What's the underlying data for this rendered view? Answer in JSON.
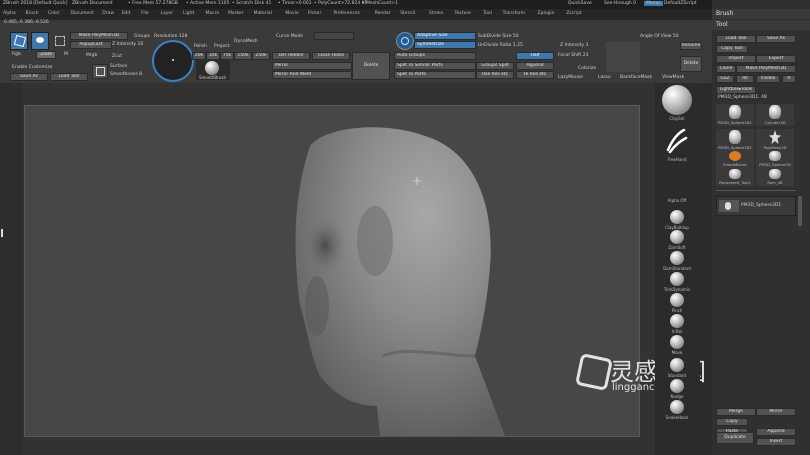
{
  "titlebar": {
    "app": "ZBrush 2018 [Default Quick]",
    "document": "ZBrush Document",
    "free_mem": "• Free Mem 57.278GB",
    "active_mem": "• Active Mem 1105",
    "scratch": "• Scratch Disk 41",
    "timer": "• Timer>0.001",
    "polycount": "• PolyCount>72.824 KP",
    "meshcount": "• MeshCount>1",
    "quicksave": "QuickSave",
    "see_through": "See-through 0",
    "menus": "Menus",
    "default_zscript": "DefaultZScript"
  },
  "menubar": [
    "Alpha",
    "Brush",
    "Color",
    "Document",
    "Draw",
    "Edit",
    "File",
    "Layer",
    "Light",
    "Macro",
    "Marker",
    "Material",
    "Movie",
    "Picker",
    "Preferences",
    "Render",
    "Stencil",
    "Stroke",
    "Texture",
    "Tool",
    "Transform",
    "Zplugin",
    "Zscript"
  ],
  "coords": "0.485,-0.386,-0.526",
  "toolbar": {
    "edit_label": "Edit",
    "draw_label": "Draw",
    "make_polymesh": "Make PolyMesh3D",
    "popup_last": "PopupLast",
    "rgb": "Rgb",
    "m": "M",
    "mrgb": "Mrgb",
    "zadd": "Zadd",
    "zsub": "Zsub",
    "zcut": "Zcut",
    "rgb_intensity": "Rgb Intensity",
    "z_intensity": "Z Intensity 10",
    "focal_shift": "Focal Shift 0",
    "enable_customize": "Enable Customize",
    "save_as": "Save As",
    "load_tool": "Load Tool",
    "scale": "Scale",
    "surface": "Surface",
    "smoothness": "Smoothness 8",
    "groups": "Groups",
    "resolution": "Resolution 128",
    "polish": "Polish",
    "project": "Project",
    "dynamesh": "DynaMesh",
    "preset_20k": "20k",
    "preset_35k": "35k",
    "preset_75k": "75k",
    "preset_150k": "150k",
    "preset_250k": "250k",
    "smoothbrush": "SmoothBrush",
    "curve_mode": "Curve Mode",
    "del_hidden": "Del Hidden",
    "close_holes": "Close Holes",
    "mirror": "Mirror",
    "mirror_and_weld": "Mirror And Weld",
    "delete": "Delete",
    "adaptive_size": "Adaptive Size",
    "symmetrize": "Symmetrize",
    "auto_groups": "Auto Groups",
    "split_to_similar": "Split To Similar Parts",
    "split_to_parts": "Split To Parts",
    "subdivide_size": "SubDivide Size 50",
    "undivide_ratio": "UnDivide Ratio 1.25",
    "groups_split": "Groups Split",
    "use_res_etc": "Use Res etc",
    "half": "Half",
    "append": "Append",
    "hi_res_etc": "Hi Res etc",
    "z_intensity2": "Z Intensity 3",
    "focal_shift2": "Focal Shift 23",
    "colorize": "Colorize",
    "lazymouse": "LazyMouse",
    "lasso": "Lasso",
    "backfacemask": "BackfaceMask",
    "viewmask": "ViewMask",
    "angle_of_view": "Angle Of View 50",
    "rename": "Rename",
    "delete2": "Delete"
  },
  "brushes": [
    {
      "name": "ClaySm",
      "kind": "sphere"
    },
    {
      "name": "FreeHand",
      "kind": "stroke"
    },
    {
      "name": "Alpha Off",
      "kind": "empty"
    },
    {
      "name": "ClayBuildup",
      "kind": "sphere"
    },
    {
      "name": "DamSoft",
      "kind": "sphere"
    },
    {
      "name": "DamStandard",
      "kind": "sphere"
    },
    {
      "name": "TrimDynamic",
      "kind": "sphere"
    },
    {
      "name": "Pinch",
      "kind": "sphere"
    },
    {
      "name": "Inflat",
      "kind": "sphere"
    },
    {
      "name": "Move",
      "kind": "sphere"
    },
    {
      "name": "Standard",
      "kind": "sphere"
    },
    {
      "name": "Nudge",
      "kind": "sphere"
    },
    {
      "name": "SnakeHook",
      "kind": "sphere"
    }
  ],
  "rightpanel": {
    "brush_header": "Brush",
    "tool_header": "Tool",
    "load_tool": "Load Tool",
    "save_as": "Save As",
    "copy_tool": "Copy Tool",
    "import": "Import",
    "export": "Export",
    "clone": "Clone",
    "make_polymesh": "Make PolyMesh3D",
    "goz": "GoZ",
    "all": "All",
    "visible": "Visible",
    "r": "R",
    "lightbox_tools": "Lightbox▸Tools",
    "current_tool": "PM3D_Sphere3D1. 48",
    "thumbs": [
      "PM3D_Sphere3D1",
      "Cylinder3D",
      "PM3D_Sphere3D1",
      "PolyMesh3D",
      "SimpleBrush",
      "PM3D_Sphere3D",
      "Recovered_Tool1",
      "Rom_46"
    ],
    "subtool_item": "PM3D_Sphere3D1",
    "merge": "Merge",
    "mirror": "Mirror",
    "copy": "Copy",
    "paste": "Paste",
    "duplicate": "Duplicate",
    "append": "Append",
    "insert": "Insert"
  },
  "watermark": {
    "cn": "灵感中国",
    "site": "lingganchina.com"
  },
  "colors": {
    "accent_blue": "#3b78b0",
    "orange": "#e07a1f"
  }
}
